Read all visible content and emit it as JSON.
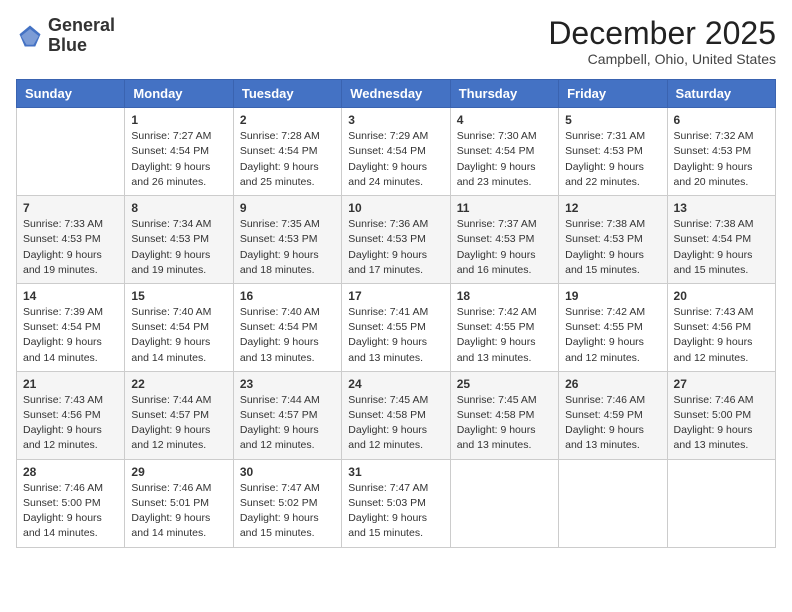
{
  "header": {
    "logo_line1": "General",
    "logo_line2": "Blue",
    "month_title": "December 2025",
    "location": "Campbell, Ohio, United States"
  },
  "weekdays": [
    "Sunday",
    "Monday",
    "Tuesday",
    "Wednesday",
    "Thursday",
    "Friday",
    "Saturday"
  ],
  "weeks": [
    [
      {
        "day": "",
        "sunrise": "",
        "sunset": "",
        "daylight": ""
      },
      {
        "day": "1",
        "sunrise": "Sunrise: 7:27 AM",
        "sunset": "Sunset: 4:54 PM",
        "daylight": "Daylight: 9 hours and 26 minutes."
      },
      {
        "day": "2",
        "sunrise": "Sunrise: 7:28 AM",
        "sunset": "Sunset: 4:54 PM",
        "daylight": "Daylight: 9 hours and 25 minutes."
      },
      {
        "day": "3",
        "sunrise": "Sunrise: 7:29 AM",
        "sunset": "Sunset: 4:54 PM",
        "daylight": "Daylight: 9 hours and 24 minutes."
      },
      {
        "day": "4",
        "sunrise": "Sunrise: 7:30 AM",
        "sunset": "Sunset: 4:54 PM",
        "daylight": "Daylight: 9 hours and 23 minutes."
      },
      {
        "day": "5",
        "sunrise": "Sunrise: 7:31 AM",
        "sunset": "Sunset: 4:53 PM",
        "daylight": "Daylight: 9 hours and 22 minutes."
      },
      {
        "day": "6",
        "sunrise": "Sunrise: 7:32 AM",
        "sunset": "Sunset: 4:53 PM",
        "daylight": "Daylight: 9 hours and 20 minutes."
      }
    ],
    [
      {
        "day": "7",
        "sunrise": "Sunrise: 7:33 AM",
        "sunset": "Sunset: 4:53 PM",
        "daylight": "Daylight: 9 hours and 19 minutes."
      },
      {
        "day": "8",
        "sunrise": "Sunrise: 7:34 AM",
        "sunset": "Sunset: 4:53 PM",
        "daylight": "Daylight: 9 hours and 19 minutes."
      },
      {
        "day": "9",
        "sunrise": "Sunrise: 7:35 AM",
        "sunset": "Sunset: 4:53 PM",
        "daylight": "Daylight: 9 hours and 18 minutes."
      },
      {
        "day": "10",
        "sunrise": "Sunrise: 7:36 AM",
        "sunset": "Sunset: 4:53 PM",
        "daylight": "Daylight: 9 hours and 17 minutes."
      },
      {
        "day": "11",
        "sunrise": "Sunrise: 7:37 AM",
        "sunset": "Sunset: 4:53 PM",
        "daylight": "Daylight: 9 hours and 16 minutes."
      },
      {
        "day": "12",
        "sunrise": "Sunrise: 7:38 AM",
        "sunset": "Sunset: 4:53 PM",
        "daylight": "Daylight: 9 hours and 15 minutes."
      },
      {
        "day": "13",
        "sunrise": "Sunrise: 7:38 AM",
        "sunset": "Sunset: 4:54 PM",
        "daylight": "Daylight: 9 hours and 15 minutes."
      }
    ],
    [
      {
        "day": "14",
        "sunrise": "Sunrise: 7:39 AM",
        "sunset": "Sunset: 4:54 PM",
        "daylight": "Daylight: 9 hours and 14 minutes."
      },
      {
        "day": "15",
        "sunrise": "Sunrise: 7:40 AM",
        "sunset": "Sunset: 4:54 PM",
        "daylight": "Daylight: 9 hours and 14 minutes."
      },
      {
        "day": "16",
        "sunrise": "Sunrise: 7:40 AM",
        "sunset": "Sunset: 4:54 PM",
        "daylight": "Daylight: 9 hours and 13 minutes."
      },
      {
        "day": "17",
        "sunrise": "Sunrise: 7:41 AM",
        "sunset": "Sunset: 4:55 PM",
        "daylight": "Daylight: 9 hours and 13 minutes."
      },
      {
        "day": "18",
        "sunrise": "Sunrise: 7:42 AM",
        "sunset": "Sunset: 4:55 PM",
        "daylight": "Daylight: 9 hours and 13 minutes."
      },
      {
        "day": "19",
        "sunrise": "Sunrise: 7:42 AM",
        "sunset": "Sunset: 4:55 PM",
        "daylight": "Daylight: 9 hours and 12 minutes."
      },
      {
        "day": "20",
        "sunrise": "Sunrise: 7:43 AM",
        "sunset": "Sunset: 4:56 PM",
        "daylight": "Daylight: 9 hours and 12 minutes."
      }
    ],
    [
      {
        "day": "21",
        "sunrise": "Sunrise: 7:43 AM",
        "sunset": "Sunset: 4:56 PM",
        "daylight": "Daylight: 9 hours and 12 minutes."
      },
      {
        "day": "22",
        "sunrise": "Sunrise: 7:44 AM",
        "sunset": "Sunset: 4:57 PM",
        "daylight": "Daylight: 9 hours and 12 minutes."
      },
      {
        "day": "23",
        "sunrise": "Sunrise: 7:44 AM",
        "sunset": "Sunset: 4:57 PM",
        "daylight": "Daylight: 9 hours and 12 minutes."
      },
      {
        "day": "24",
        "sunrise": "Sunrise: 7:45 AM",
        "sunset": "Sunset: 4:58 PM",
        "daylight": "Daylight: 9 hours and 12 minutes."
      },
      {
        "day": "25",
        "sunrise": "Sunrise: 7:45 AM",
        "sunset": "Sunset: 4:58 PM",
        "daylight": "Daylight: 9 hours and 13 minutes."
      },
      {
        "day": "26",
        "sunrise": "Sunrise: 7:46 AM",
        "sunset": "Sunset: 4:59 PM",
        "daylight": "Daylight: 9 hours and 13 minutes."
      },
      {
        "day": "27",
        "sunrise": "Sunrise: 7:46 AM",
        "sunset": "Sunset: 5:00 PM",
        "daylight": "Daylight: 9 hours and 13 minutes."
      }
    ],
    [
      {
        "day": "28",
        "sunrise": "Sunrise: 7:46 AM",
        "sunset": "Sunset: 5:00 PM",
        "daylight": "Daylight: 9 hours and 14 minutes."
      },
      {
        "day": "29",
        "sunrise": "Sunrise: 7:46 AM",
        "sunset": "Sunset: 5:01 PM",
        "daylight": "Daylight: 9 hours and 14 minutes."
      },
      {
        "day": "30",
        "sunrise": "Sunrise: 7:47 AM",
        "sunset": "Sunset: 5:02 PM",
        "daylight": "Daylight: 9 hours and 15 minutes."
      },
      {
        "day": "31",
        "sunrise": "Sunrise: 7:47 AM",
        "sunset": "Sunset: 5:03 PM",
        "daylight": "Daylight: 9 hours and 15 minutes."
      },
      {
        "day": "",
        "sunrise": "",
        "sunset": "",
        "daylight": ""
      },
      {
        "day": "",
        "sunrise": "",
        "sunset": "",
        "daylight": ""
      },
      {
        "day": "",
        "sunrise": "",
        "sunset": "",
        "daylight": ""
      }
    ]
  ]
}
